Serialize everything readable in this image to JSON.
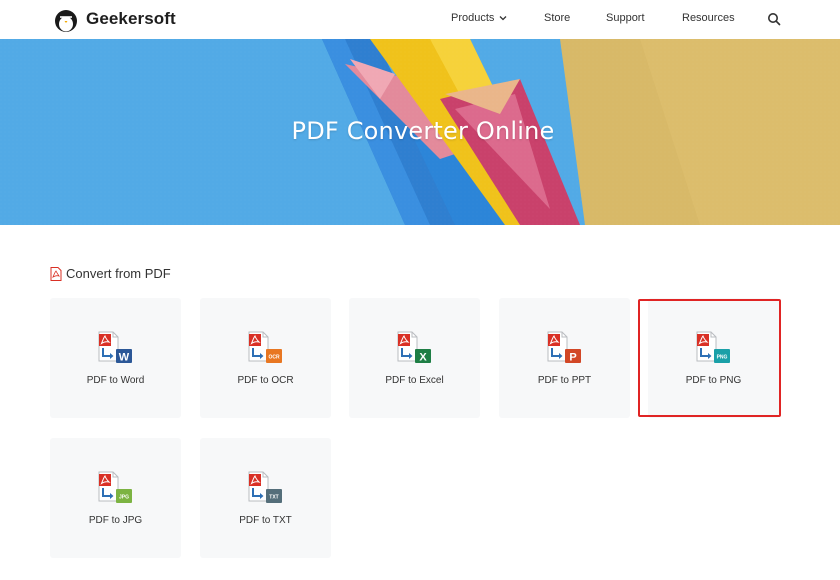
{
  "header": {
    "brand": "Geekersoft",
    "nav": [
      {
        "label": "Products",
        "has_dropdown": true
      },
      {
        "label": "Store"
      },
      {
        "label": "Support"
      },
      {
        "label": "Resources"
      }
    ]
  },
  "hero": {
    "title": "PDF Converter Online"
  },
  "section": {
    "title": "Convert from PDF"
  },
  "tools": [
    {
      "label": "PDF to Word",
      "badge": "W",
      "color": "#2b5797"
    },
    {
      "label": "PDF to OCR",
      "badge": "OCR",
      "color": "#e87722"
    },
    {
      "label": "PDF to Excel",
      "badge": "X",
      "color": "#1e7e45"
    },
    {
      "label": "PDF to PPT",
      "badge": "P",
      "color": "#d24726"
    },
    {
      "label": "PDF to PNG",
      "badge": "PNG",
      "color": "#1aa0a8",
      "selected": true
    },
    {
      "label": "PDF to JPG",
      "badge": "JPG",
      "color": "#7cb342"
    },
    {
      "label": "PDF to TXT",
      "badge": "TXT",
      "color": "#546e7a"
    }
  ],
  "colors": {
    "pdf_red": "#d93025",
    "arrow_blue": "#2d6fb5",
    "highlight": "#e02424"
  }
}
